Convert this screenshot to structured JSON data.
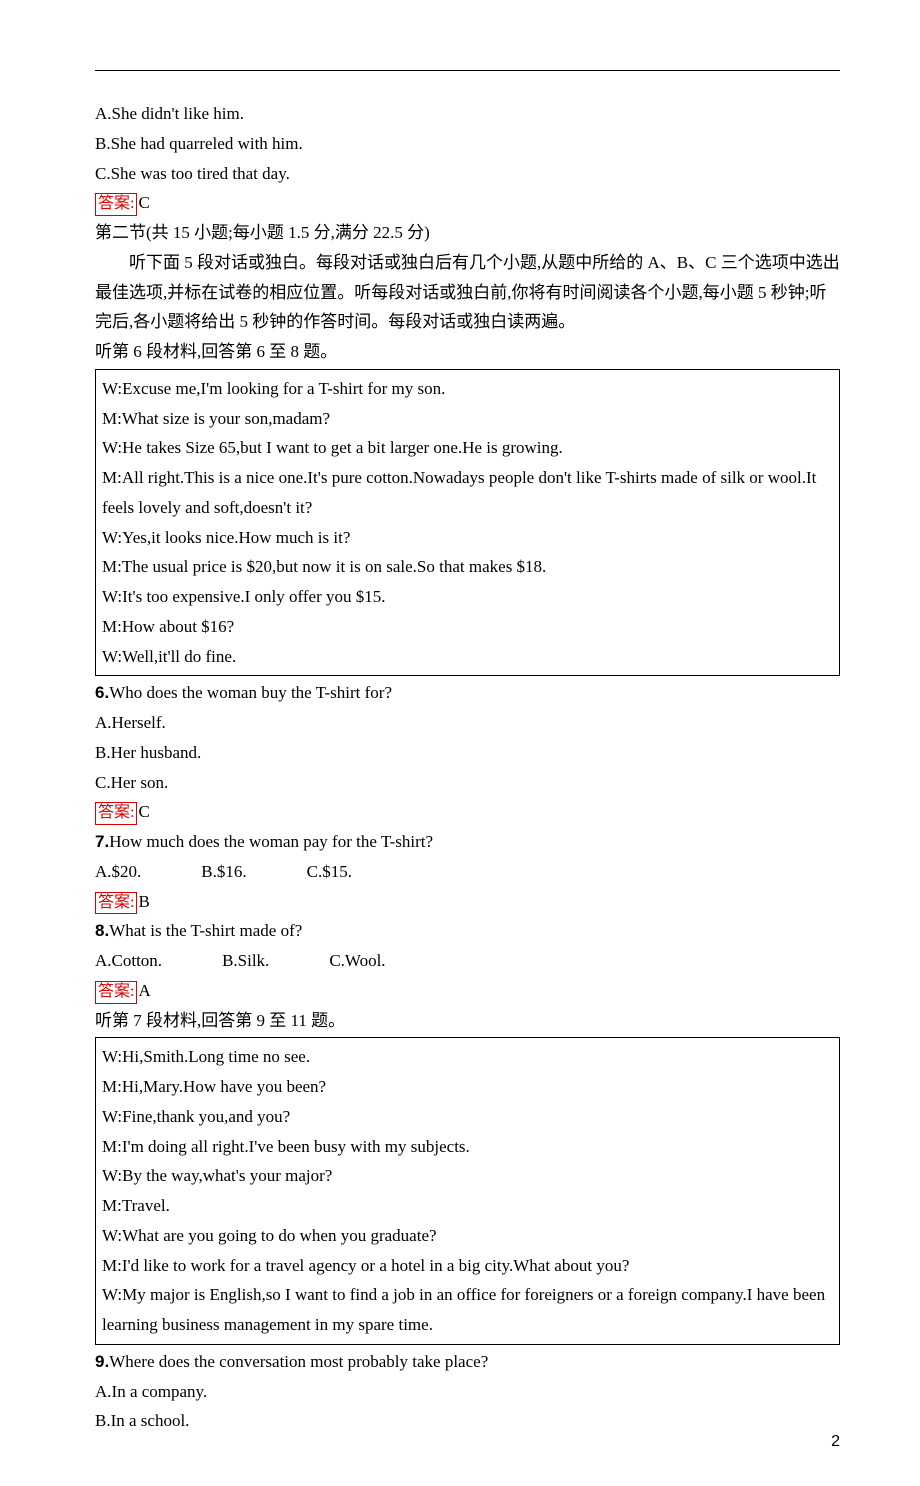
{
  "hr": "",
  "q5": {
    "opts": {
      "a": "A.She didn't like him.",
      "b": "B.She had quarreled with him.",
      "c": "C.She was too tired that day."
    },
    "ans_label": "答案:",
    "ans_value": "C"
  },
  "section2": {
    "title": "第二节(共 15 小题;每小题 1.5 分,满分 22.5 分)",
    "desc": "听下面 5 段对话或独白。每段对话或独白后有几个小题,从题中所给的 A、B、C 三个选项中选出最佳选项,并标在试卷的相应位置。听每段对话或独白前,你将有时间阅读各个小题,每小题 5 秒钟;听完后,各小题将给出 5 秒钟的作答时间。每段对话或独白读两遍。",
    "mat6_intro": "听第 6 段材料,回答第 6 至 8 题。"
  },
  "dialog6": {
    "l1": "W:Excuse me,I'm looking for a T-shirt for my son.",
    "l2": "M:What size is your son,madam?",
    "l3": "W:He takes Size 65,but I want to get a bit larger one.He is growing.",
    "l4": "M:All right.This is a nice one.It's pure cotton.Nowadays people don't like T-shirts made of silk or wool.It feels lovely and soft,doesn't it?",
    "l5": "W:Yes,it looks nice.How much is it?",
    "l6": "M:The usual price is $20,but now it is on sale.So that makes $18.",
    "l7": "W:It's too expensive.I only offer you $15.",
    "l8": "M:How about $16?",
    "l9": "W:Well,it'll do fine."
  },
  "q6": {
    "num": "6.",
    "text": "Who does the woman buy the T-shirt for?",
    "opts": {
      "a": "A.Herself.",
      "b": "B.Her husband.",
      "c": "C.Her son."
    },
    "ans_label": "答案:",
    "ans_value": "C"
  },
  "q7": {
    "num": "7.",
    "text": "How much does the woman pay for the T-shirt?",
    "opts": {
      "a": "A.$20.",
      "b": "B.$16.",
      "c": "C.$15."
    },
    "ans_label": "答案:",
    "ans_value": "B"
  },
  "q8": {
    "num": "8.",
    "text": "What is the T-shirt made of?",
    "opts": {
      "a": "A.Cotton.",
      "b": "B.Silk.",
      "c": "C.Wool."
    },
    "ans_label": "答案:",
    "ans_value": "A"
  },
  "mat7_intro": "听第 7 段材料,回答第 9 至 11 题。",
  "dialog7": {
    "l1": "W:Hi,Smith.Long time no see.",
    "l2": "M:Hi,Mary.How have you been?",
    "l3": "W:Fine,thank you,and you?",
    "l4": "M:I'm doing all right.I've been busy with my subjects.",
    "l5": "W:By the way,what's your major?",
    "l6": "M:Travel.",
    "l7": "W:What are you going to do when you graduate?",
    "l8": "M:I'd like to work for a travel agency or a hotel in a big city.What about you?",
    "l9": "W:My major is English,so I want to find a job in an office for foreigners or a foreign company.I have been learning business management in my spare time."
  },
  "q9": {
    "num": "9.",
    "text": "Where does the conversation most probably take place?",
    "opts": {
      "a": "A.In a company.",
      "b": "B.In a school."
    }
  },
  "page_number": "2"
}
